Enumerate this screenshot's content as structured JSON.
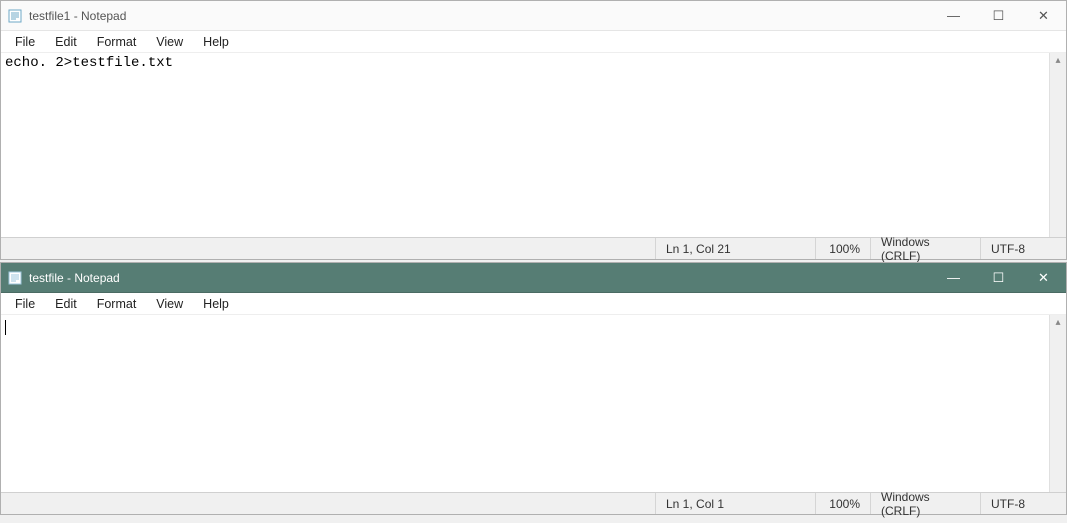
{
  "windows": [
    {
      "title": "testfile1 - Notepad",
      "active": false,
      "menu": [
        "File",
        "Edit",
        "Format",
        "View",
        "Help"
      ],
      "content": "echo. 2>testfile.txt",
      "status": {
        "position": "Ln 1, Col 21",
        "zoom": "100%",
        "eol": "Windows (CRLF)",
        "encoding": "UTF-8"
      }
    },
    {
      "title": "testfile - Notepad",
      "active": true,
      "menu": [
        "File",
        "Edit",
        "Format",
        "View",
        "Help"
      ],
      "content": "",
      "status": {
        "position": "Ln 1, Col 1",
        "zoom": "100%",
        "eol": "Windows (CRLF)",
        "encoding": "UTF-8"
      }
    }
  ],
  "window_controls": {
    "minimize": "—",
    "maximize": "☐",
    "close": "✕"
  }
}
